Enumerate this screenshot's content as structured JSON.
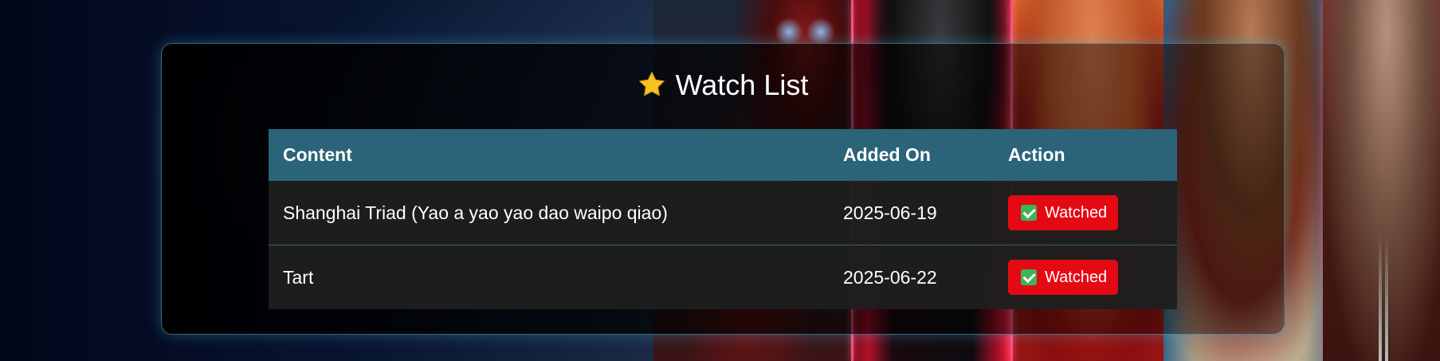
{
  "page": {
    "title": "Watch List",
    "title_icon": "star-icon"
  },
  "table": {
    "headers": {
      "content": "Content",
      "added_on": "Added On",
      "action": "Action"
    },
    "rows": [
      {
        "content": "Shanghai Triad (Yao a yao yao dao waipo qiao)",
        "added_on": "2025-06-19",
        "action_label": "Watched",
        "action_icon": "checkbox-checked-icon"
      },
      {
        "content": "Tart",
        "added_on": "2025-06-22",
        "action_label": "Watched",
        "action_icon": "checkbox-checked-icon"
      }
    ]
  },
  "colors": {
    "header_bg": "#2b6478",
    "button_bg": "#e50914",
    "row_bg": "#1e1e1e",
    "panel_border": "#5abedc",
    "check_bg": "#3cb45a"
  }
}
